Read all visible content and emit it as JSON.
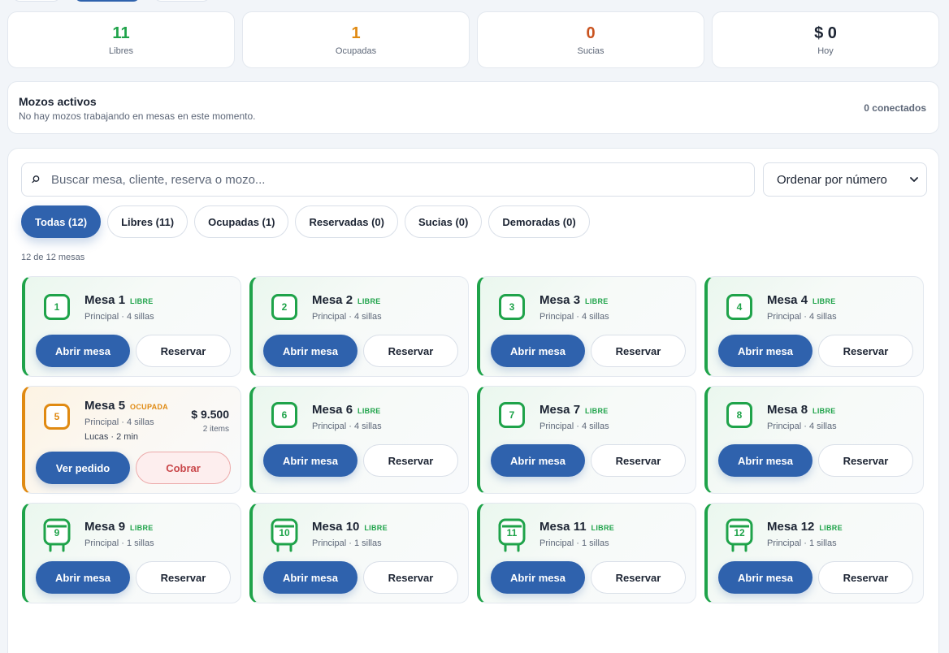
{
  "stats": [
    {
      "value": "11",
      "label": "Libres",
      "color": "#1fa34a"
    },
    {
      "value": "1",
      "label": "Ocupadas",
      "color": "#e08a12"
    },
    {
      "value": "0",
      "label": "Sucias",
      "color": "#c9531f"
    },
    {
      "value": "$ 0",
      "label": "Hoy",
      "color": "#1c2433"
    }
  ],
  "mozos": {
    "title": "Mozos activos",
    "subtitle": "No hay mozos trabajando en mesas en este momento.",
    "count": "0 conectados"
  },
  "search": {
    "placeholder": "Buscar mesa, cliente, reserva o mozo...",
    "icon": "search-icon"
  },
  "sort": {
    "selected": "Ordenar por número"
  },
  "filters": [
    {
      "label": "Todas (12)",
      "active": true
    },
    {
      "label": "Libres (11)",
      "active": false
    },
    {
      "label": "Ocupadas (1)",
      "active": false
    },
    {
      "label": "Reservadas (0)",
      "active": false
    },
    {
      "label": "Sucias (0)",
      "active": false
    },
    {
      "label": "Demoradas (0)",
      "active": false
    }
  ],
  "count_label": "12 de 12 mesas",
  "colors": {
    "free": "#1fa34a",
    "busy": "#e08a12",
    "primary": "#2f62ad"
  },
  "tables": [
    {
      "number": "1",
      "name": "Mesa 1",
      "status": "LIBRE",
      "info": "Principal · 4 sillas",
      "primary": "Abrir mesa",
      "secondary": "Reservar",
      "icon": "table-icon"
    },
    {
      "number": "2",
      "name": "Mesa 2",
      "status": "LIBRE",
      "info": "Principal · 4 sillas",
      "primary": "Abrir mesa",
      "secondary": "Reservar",
      "icon": "table-icon"
    },
    {
      "number": "3",
      "name": "Mesa 3",
      "status": "LIBRE",
      "info": "Principal · 4 sillas",
      "primary": "Abrir mesa",
      "secondary": "Reservar",
      "icon": "table-icon"
    },
    {
      "number": "4",
      "name": "Mesa 4",
      "status": "LIBRE",
      "info": "Principal · 4 sillas",
      "primary": "Abrir mesa",
      "secondary": "Reservar",
      "icon": "table-icon"
    },
    {
      "number": "5",
      "name": "Mesa 5",
      "status": "OCUPADA",
      "info": "Principal · 4 sillas",
      "waiter": "Lucas · 2 min",
      "amount": "$ 9.500",
      "items": "2 items",
      "primary": "Ver pedido",
      "secondary": "Cobrar",
      "icon": "table-icon"
    },
    {
      "number": "6",
      "name": "Mesa 6",
      "status": "LIBRE",
      "info": "Principal · 4 sillas",
      "primary": "Abrir mesa",
      "secondary": "Reservar",
      "icon": "table-icon"
    },
    {
      "number": "7",
      "name": "Mesa 7",
      "status": "LIBRE",
      "info": "Principal · 4 sillas",
      "primary": "Abrir mesa",
      "secondary": "Reservar",
      "icon": "table-icon"
    },
    {
      "number": "8",
      "name": "Mesa 8",
      "status": "LIBRE",
      "info": "Principal · 4 sillas",
      "primary": "Abrir mesa",
      "secondary": "Reservar",
      "icon": "table-icon"
    },
    {
      "number": "9",
      "name": "Mesa 9",
      "status": "LIBRE",
      "info": "Principal · 1 sillas",
      "primary": "Abrir mesa",
      "secondary": "Reservar",
      "icon": "stool-icon"
    },
    {
      "number": "10",
      "name": "Mesa 10",
      "status": "LIBRE",
      "info": "Principal · 1 sillas",
      "primary": "Abrir mesa",
      "secondary": "Reservar",
      "icon": "stool-icon"
    },
    {
      "number": "11",
      "name": "Mesa 11",
      "status": "LIBRE",
      "info": "Principal · 1 sillas",
      "primary": "Abrir mesa",
      "secondary": "Reservar",
      "icon": "stool-icon"
    },
    {
      "number": "12",
      "name": "Mesa 12",
      "status": "LIBRE",
      "info": "Principal · 1 sillas",
      "primary": "Abrir mesa",
      "secondary": "Reservar",
      "icon": "stool-icon"
    }
  ]
}
